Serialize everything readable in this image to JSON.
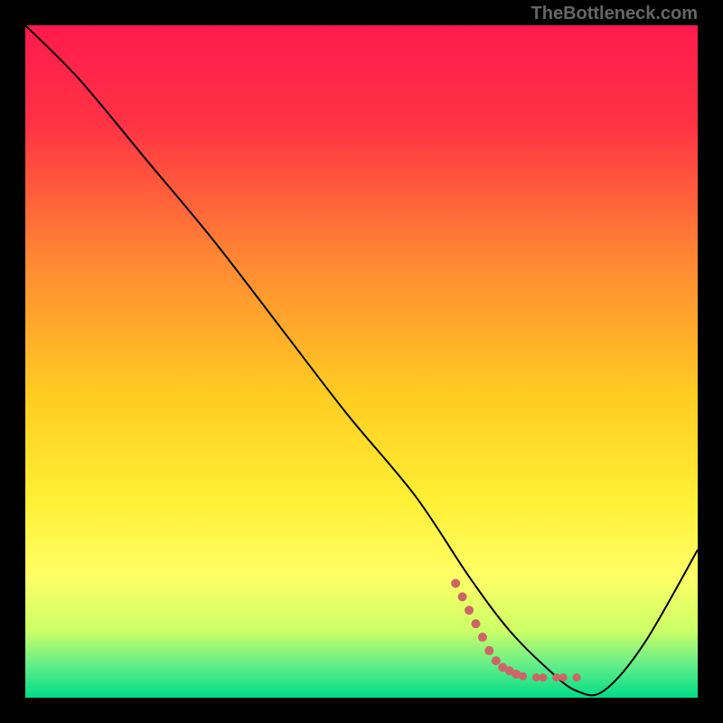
{
  "watermark": "TheBottleneck.com",
  "chart_data": {
    "type": "line",
    "title": "",
    "xlabel": "",
    "ylabel": "",
    "xlim": [
      0,
      100
    ],
    "ylim": [
      0,
      100
    ],
    "background_gradient": {
      "type": "vertical",
      "stops": [
        {
          "pct": 0,
          "color": "#ff1a4d"
        },
        {
          "pct": 15,
          "color": "#ff3344"
        },
        {
          "pct": 35,
          "color": "#ff8833"
        },
        {
          "pct": 55,
          "color": "#ffcc22"
        },
        {
          "pct": 70,
          "color": "#ffee33"
        },
        {
          "pct": 82,
          "color": "#ffff66"
        },
        {
          "pct": 90,
          "color": "#ccff66"
        },
        {
          "pct": 95,
          "color": "#66ee88"
        },
        {
          "pct": 100,
          "color": "#00dd88"
        }
      ]
    },
    "series": [
      {
        "name": "bottleneck-curve",
        "color": "#000000",
        "x": [
          0,
          8,
          18,
          28,
          38,
          48,
          58,
          66,
          72,
          78,
          82,
          86,
          92,
          100
        ],
        "y": [
          100,
          92,
          80,
          68,
          55,
          42,
          30,
          18,
          10,
          4,
          1,
          1,
          8,
          22
        ]
      }
    ],
    "highlight_points": {
      "name": "optimal-range",
      "color": "#cc6666",
      "points": [
        {
          "x": 64,
          "y": 17
        },
        {
          "x": 65,
          "y": 15
        },
        {
          "x": 66,
          "y": 13
        },
        {
          "x": 67,
          "y": 11
        },
        {
          "x": 68,
          "y": 9
        },
        {
          "x": 69,
          "y": 7
        },
        {
          "x": 70,
          "y": 5.5
        },
        {
          "x": 71,
          "y": 4.5
        },
        {
          "x": 72,
          "y": 4
        },
        {
          "x": 73,
          "y": 3.5
        },
        {
          "x": 74,
          "y": 3.2
        },
        {
          "x": 76,
          "y": 3
        },
        {
          "x": 77,
          "y": 3
        },
        {
          "x": 79,
          "y": 3
        },
        {
          "x": 80,
          "y": 3
        },
        {
          "x": 82,
          "y": 3
        }
      ]
    }
  }
}
